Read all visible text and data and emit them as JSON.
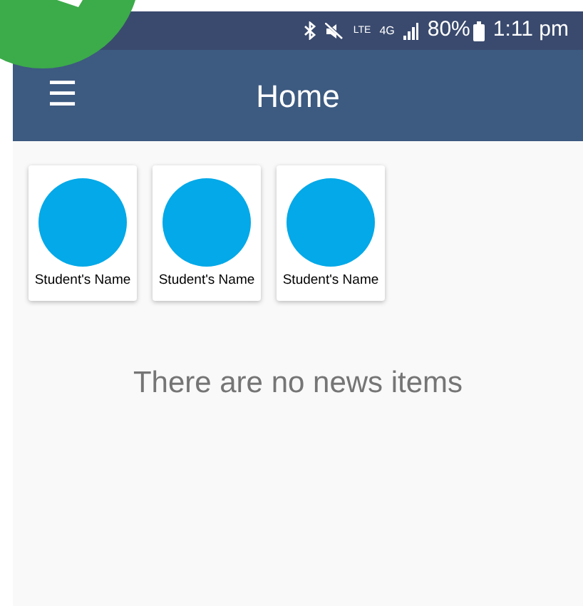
{
  "status_bar": {
    "volte": "LTE",
    "network": "4G",
    "battery": "80%",
    "time": "1:11 pm"
  },
  "app_bar": {
    "title": "Home",
    "menu_icon": "☰"
  },
  "students": [
    {
      "name": "Student's Name"
    },
    {
      "name": "Student's Name"
    },
    {
      "name": "Student's Name"
    }
  ],
  "empty_message": "There are no news items"
}
